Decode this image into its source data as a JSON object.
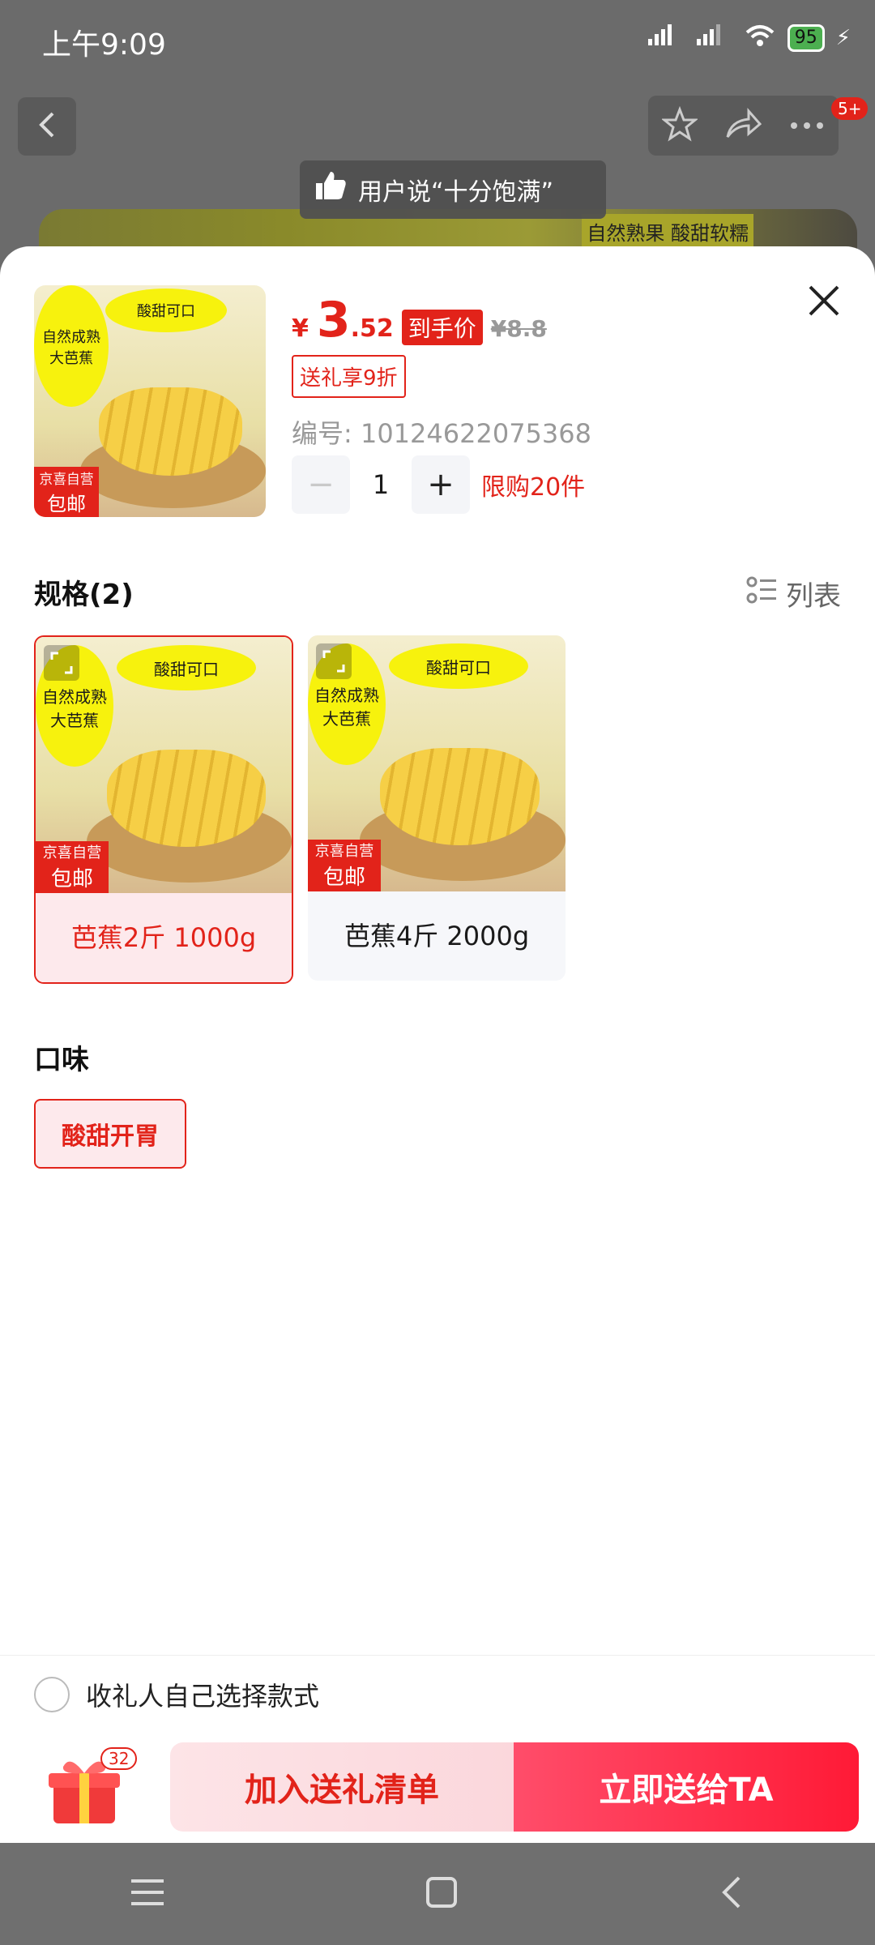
{
  "status_bar": {
    "time": "上午9:09",
    "battery": "95"
  },
  "header": {
    "cart_badge": "5+"
  },
  "toast": {
    "text": "用户说“十分饱满”"
  },
  "banner": {
    "text": "自然熟果 酸甜软糯"
  },
  "product": {
    "price_symbol": "¥",
    "price_int": "3",
    "price_dec": ".52",
    "price_tag": "到手价",
    "original_price": "¥8.8",
    "coupon": "送礼享9折",
    "sku": "编号: 10124622075368",
    "quantity": "1",
    "limit": "限购20件",
    "thumb": {
      "oval_left": "自然成熟\n大芭蕉",
      "oval_top": "酸甜可口",
      "tag_top": "京喜自营",
      "tag_main": "包邮"
    }
  },
  "spec": {
    "title": "规格(2)",
    "list_label": "列表",
    "items": [
      {
        "label": "芭蕉2斤 1000g",
        "selected": true
      },
      {
        "label": "芭蕉4斤 2000g",
        "selected": false
      }
    ]
  },
  "flavor": {
    "title": "口味",
    "options": [
      {
        "label": "酸甜开胃",
        "selected": true
      }
    ]
  },
  "self_choose": {
    "label": "收礼人自己选择款式"
  },
  "bottom": {
    "gift_count": "32",
    "add_label": "加入送礼清单",
    "send_label": "立即送给TA"
  },
  "colors": {
    "accent": "#e2231a",
    "accent_light": "#fde9ec"
  },
  "icons": [
    "back-icon",
    "star-icon",
    "share-icon",
    "more-icon",
    "thumbs-up-icon",
    "close-icon",
    "list-icon",
    "gift-icon",
    "menu-icon",
    "home-icon",
    "nav-back-icon",
    "expand-icon"
  ]
}
